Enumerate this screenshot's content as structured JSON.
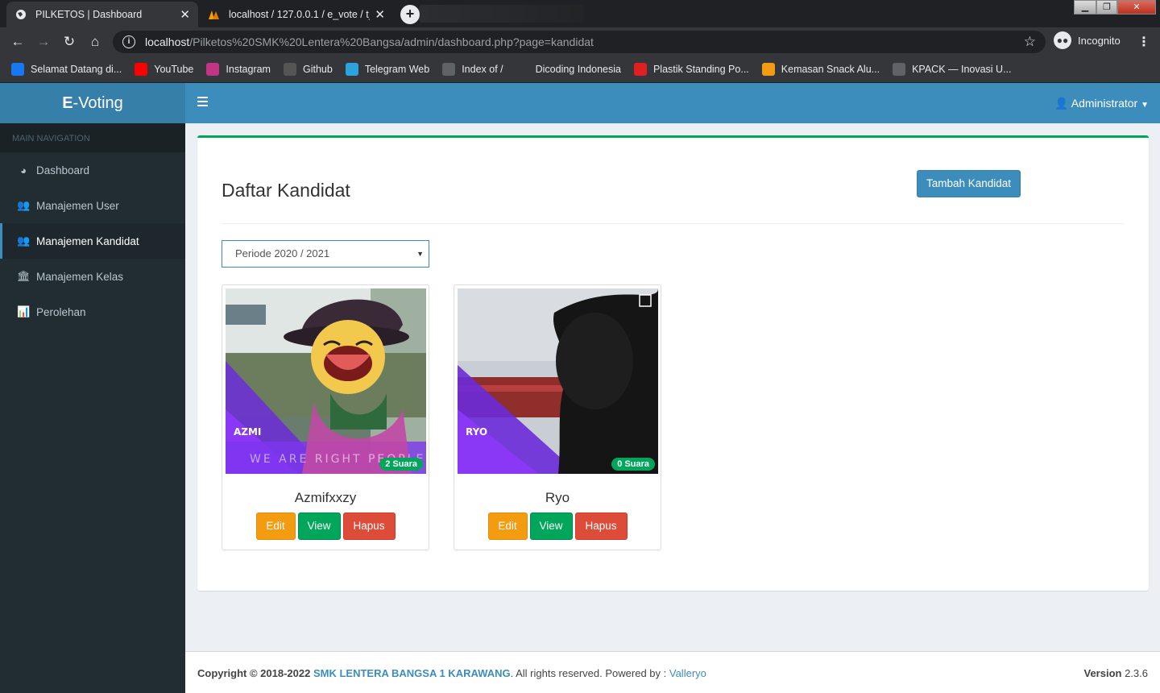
{
  "browser": {
    "tabs": [
      {
        "title": "PILKETOS | Dashboard",
        "active": true
      },
      {
        "title": "localhost / 127.0.0.1 / e_vote / t_",
        "active": false
      }
    ],
    "url_host": "localhost",
    "url_path": "/Pilketos%20SMK%20Lentera%20Bangsa/admin/dashboard.php?page=kandidat",
    "incognito_label": "Incognito",
    "bookmarks": [
      {
        "label": "Selamat Datang di...",
        "icon": "facebook-icon",
        "color": "#1877f2"
      },
      {
        "label": "YouTube",
        "icon": "youtube-icon",
        "color": "#ff0000"
      },
      {
        "label": "Instagram",
        "icon": "instagram-icon",
        "color": "#c13584"
      },
      {
        "label": "Github",
        "icon": "github-icon",
        "color": "#555555"
      },
      {
        "label": "Telegram Web",
        "icon": "telegram-icon",
        "color": "#2aa3df"
      },
      {
        "label": "Index of /",
        "icon": "globe-icon",
        "color": "#5f6368"
      },
      {
        "label": "Dicoding Indonesia",
        "icon": "dicoding-icon",
        "color": "#35363a"
      },
      {
        "label": "Plastik Standing Po...",
        "icon": "shop-icon",
        "color": "#e02020"
      },
      {
        "label": "Kemasan Snack Alu...",
        "icon": "k-icon",
        "color": "#f39c12"
      },
      {
        "label": "KPACK — Inovasi U...",
        "icon": "globe-icon",
        "color": "#5f6368"
      }
    ]
  },
  "app": {
    "brand_bold": "E",
    "brand_rest": "-Voting",
    "nav_header": "MAIN NAVIGATION",
    "nav": [
      {
        "label": "Dashboard",
        "icon": "dashboard-icon",
        "glyph": "◕",
        "active": false
      },
      {
        "label": "Manajemen User",
        "icon": "users-icon",
        "glyph": "👥",
        "active": false
      },
      {
        "label": "Manajemen Kandidat",
        "icon": "users-icon",
        "glyph": "👥",
        "active": true
      },
      {
        "label": "Manajemen Kelas",
        "icon": "institution-icon",
        "glyph": "🏛",
        "active": false
      },
      {
        "label": "Perolehan",
        "icon": "bar-chart-icon",
        "glyph": "📊",
        "active": false
      }
    ],
    "user_menu": "Administrator",
    "page_title": "Daftar Kandidat",
    "add_button": "Tambah Kandidat",
    "period_select": "Periode 2020 / 2021",
    "candidates": [
      {
        "name": "Azmifxxzy",
        "votes": "2 Suara",
        "photo_caption": "AZMI",
        "tagline": "WE ARE RIGHT PEOPLE"
      },
      {
        "name": "Ryo",
        "votes": "0 Suara",
        "photo_caption": "RYO",
        "tagline": ""
      }
    ],
    "buttons": {
      "edit": "Edit",
      "view": "View",
      "delete": "Hapus"
    },
    "footer": {
      "copyright": "Copyright © 2018-2022",
      "school": "SMK LENTERA BANGSA 1 KARAWANG",
      "rights": ". All rights reserved. Powered by :",
      "powered": "Valleryo",
      "version_label": "Version",
      "version": "2.3.6"
    }
  }
}
